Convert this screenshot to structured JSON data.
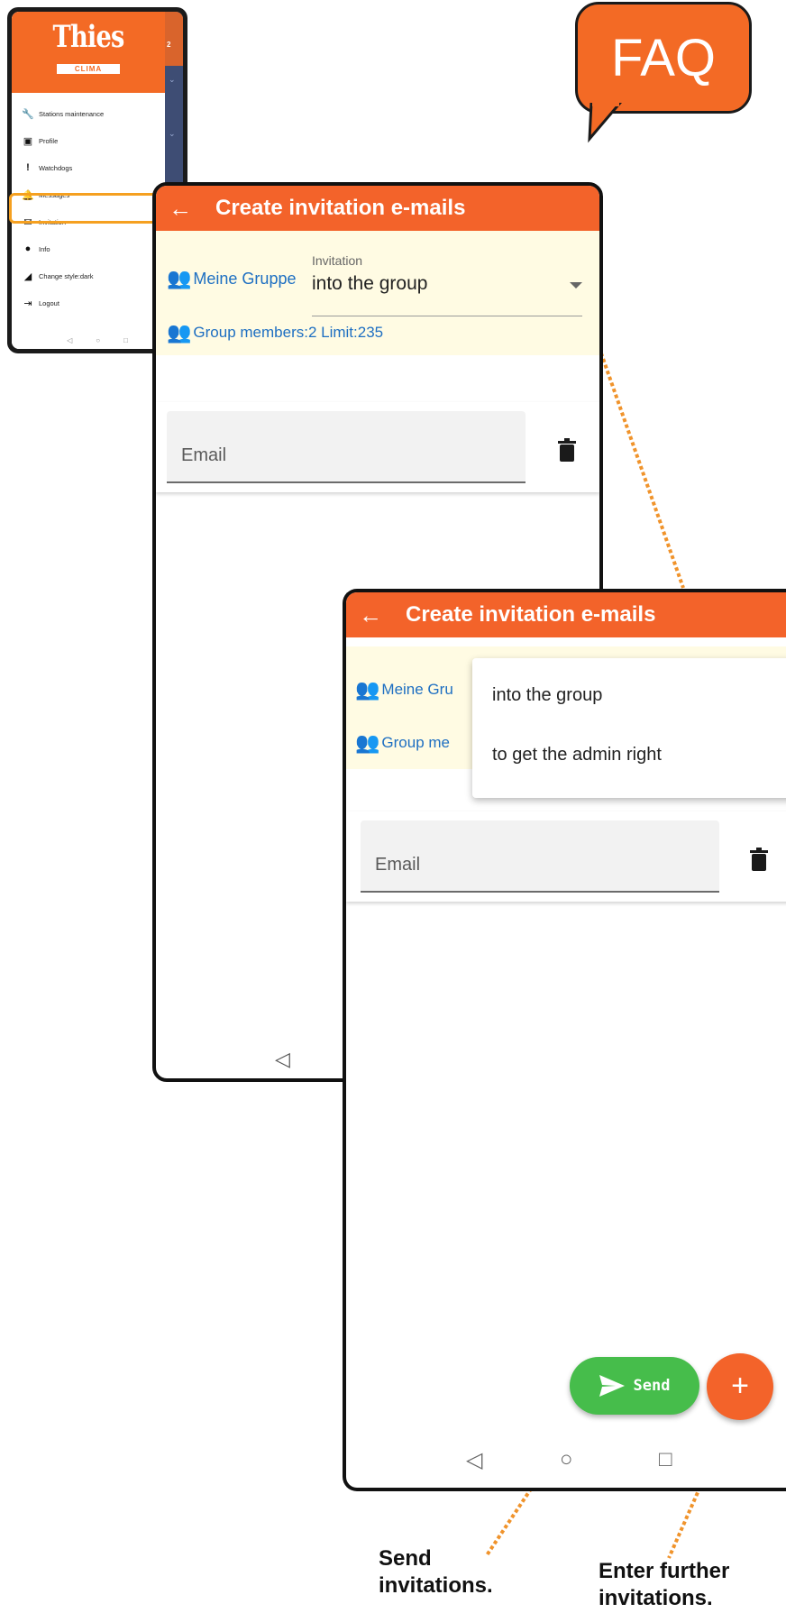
{
  "faq": {
    "label": "FAQ"
  },
  "drawer": {
    "logo": "Thies",
    "logo_sub": "CLIMA",
    "background_number": "2",
    "items": [
      {
        "icon": "wrench-icon",
        "label": "Stations maintenance"
      },
      {
        "icon": "profile-card-icon",
        "label": "Profile"
      },
      {
        "icon": "exclamation-icon",
        "label": "Watchdogs"
      },
      {
        "icon": "bell-icon",
        "label": "Messages"
      },
      {
        "icon": "envelope-icon",
        "label": "Invitation"
      },
      {
        "icon": "info-icon",
        "label": "Info"
      },
      {
        "icon": "style-icon",
        "label": "Change style:dark"
      },
      {
        "icon": "logout-icon",
        "label": "Logout"
      }
    ]
  },
  "screen": {
    "title": "Create invitation e-mails",
    "group_name": "Meine Gruppe",
    "group_name_truncated": "Meine Gru",
    "members_label": "Group members:2   Limit:235",
    "members_truncated": "Group me",
    "invitation_label": "Invitation",
    "invitation_value": "into the group",
    "email_placeholder": "Email"
  },
  "dropdown": {
    "options": [
      "into the group",
      "to get the admin right"
    ]
  },
  "actions": {
    "send_label": "Send",
    "add_label": "+"
  },
  "captions": {
    "send": "Send invitations.",
    "add": "Enter further invitations."
  },
  "colors": {
    "brand": "#f3632a",
    "send_green": "#46bd4b",
    "highlight": "#f5a020",
    "link_blue": "#1e6fc2"
  }
}
